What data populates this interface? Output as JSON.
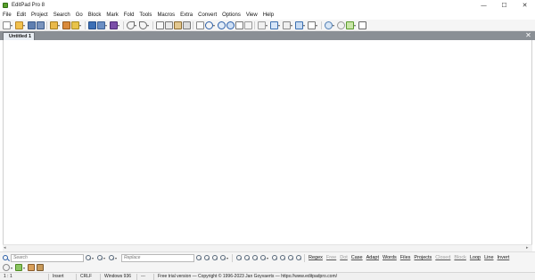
{
  "window": {
    "title": "EditPad Pro 8",
    "controls": {
      "minimize": "—",
      "maximize": "☐",
      "close": "✕"
    }
  },
  "menu": {
    "items": [
      "File",
      "Edit",
      "Project",
      "Search",
      "Go",
      "Block",
      "Mark",
      "Fold",
      "Tools",
      "Macros",
      "Extra",
      "Convert",
      "Options",
      "View",
      "Help"
    ]
  },
  "toolbar": {
    "icons": [
      "new-file-icon",
      "open-file-icon",
      "save-icon",
      "save-all-icon",
      "open-project-icon",
      "print-icon",
      "bookmark-icon",
      "color-palette-icon",
      "undo-icon",
      "redo-icon",
      "cut-icon",
      "copy-icon",
      "paste-icon",
      "clipboard-icon",
      "search-icon",
      "zoom-in-icon",
      "find-in-files-icon",
      "marker-icon",
      "spell-check-icon",
      "word-wrap-icon",
      "columns-icon",
      "grid-icon",
      "tools-icon",
      "syntax-color-icon",
      "file-navigator-icon",
      "font-icon"
    ]
  },
  "tabs": {
    "active_label": "Untitled 1",
    "close_symbol": "✕"
  },
  "editor": {
    "content": "",
    "scroll_left": "◂",
    "scroll_right": "▸"
  },
  "search": {
    "search_placeholder": "Search",
    "replace_placeholder": "Replace",
    "options": [
      {
        "label": "Regex",
        "enabled": true
      },
      {
        "label": "Free",
        "enabled": false
      },
      {
        "label": "Dot",
        "enabled": false
      },
      {
        "label": "Case",
        "enabled": true
      },
      {
        "label": "Adapt",
        "enabled": true
      },
      {
        "label": "Words",
        "enabled": true
      },
      {
        "label": "Files",
        "enabled": true
      },
      {
        "label": "Projects",
        "enabled": true
      },
      {
        "label": "Closed",
        "enabled": false
      },
      {
        "label": "Block",
        "enabled": false
      },
      {
        "label": "Loop",
        "enabled": true
      },
      {
        "label": "Line",
        "enabled": true
      },
      {
        "label": "Invert",
        "enabled": true
      }
    ]
  },
  "status": {
    "position": "1 : 1",
    "mode": "Insert",
    "line_break": "CRLF",
    "encoding": "Windows 936",
    "dashes": "---",
    "notice": "Free trial version  —  Copyright © 1996-2023  Jan Goyvaerts  —  https://www.editpadpro.com/"
  },
  "colors": {
    "tab_strip": "#8a8f95",
    "accent_green": "#5aa02c",
    "accent_blue": "#2a5ea8"
  }
}
